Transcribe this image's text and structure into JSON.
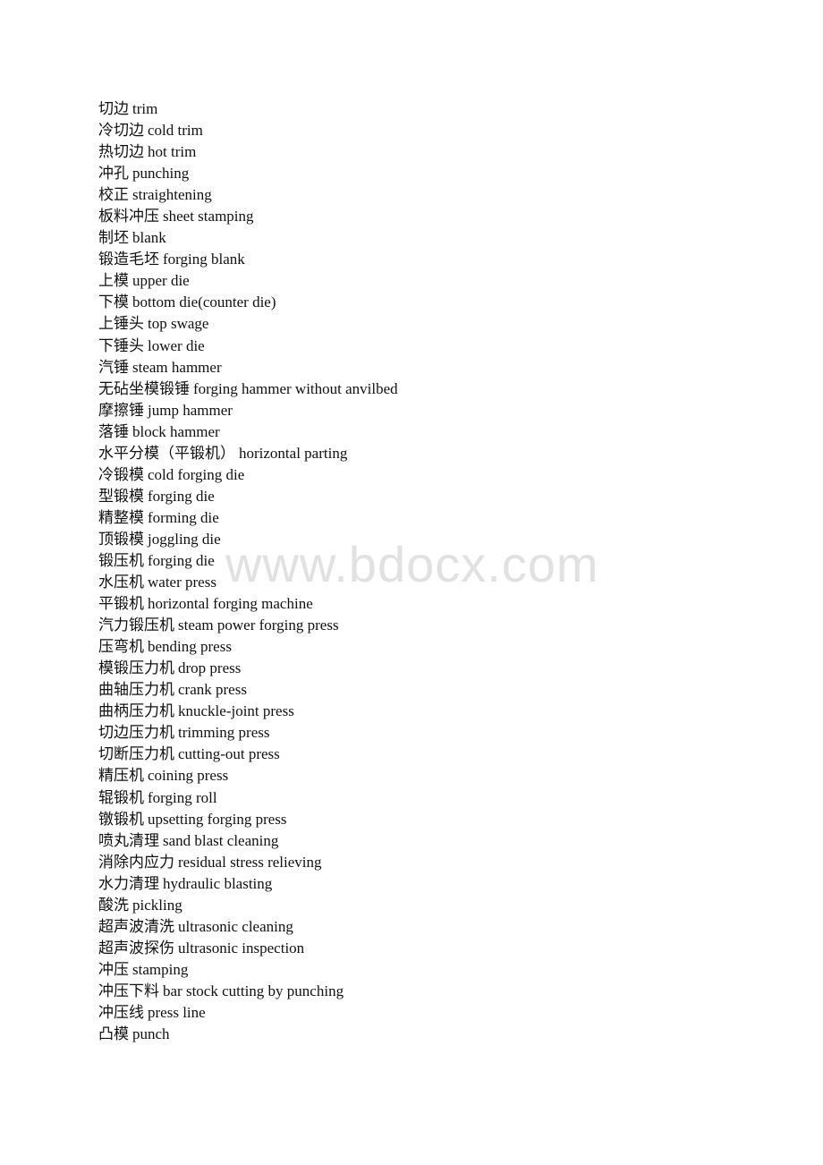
{
  "document": {
    "entries": [
      {
        "zh": "切边",
        "en": "trim"
      },
      {
        "zh": "冷切边",
        "en": "cold trim"
      },
      {
        "zh": "热切边",
        "en": "hot trim"
      },
      {
        "zh": "冲孔",
        "en": "punching"
      },
      {
        "zh": "校正",
        "en": "straightening"
      },
      {
        "zh": "板料冲压",
        "en": "sheet stamping"
      },
      {
        "zh": "制坯",
        "en": "blank"
      },
      {
        "zh": "锻造毛坯",
        "en": "forging blank"
      },
      {
        "zh": "上模",
        "en": "upper die"
      },
      {
        "zh": "下模",
        "en": "bottom die(counter die)"
      },
      {
        "zh": "上锤头",
        "en": "top swage"
      },
      {
        "zh": "下锤头",
        "en": "lower die"
      },
      {
        "zh": "汽锤",
        "en": "steam hammer"
      },
      {
        "zh": "无砧坐模锻锤",
        "en": "forging hammer without anvilbed"
      },
      {
        "zh": "摩擦锤",
        "en": "jump hammer"
      },
      {
        "zh": "落锤",
        "en": "block hammer"
      },
      {
        "zh": "水平分模（平锻机）",
        "en": "horizontal parting"
      },
      {
        "zh": "冷锻模",
        "en": "cold forging die"
      },
      {
        "zh": "型锻模",
        "en": "forging die"
      },
      {
        "zh": "精整模",
        "en": "forming die"
      },
      {
        "zh": "顶锻模",
        "en": "joggling die"
      },
      {
        "zh": "锻压机",
        "en": "forging die"
      },
      {
        "zh": "水压机",
        "en": "water press"
      },
      {
        "zh": "平锻机",
        "en": "horizontal forging machine"
      },
      {
        "zh": "汽力锻压机",
        "en": "steam power forging press"
      },
      {
        "zh": "压弯机",
        "en": "bending press"
      },
      {
        "zh": "模锻压力机",
        "en": "drop press"
      },
      {
        "zh": "曲轴压力机",
        "en": "crank press"
      },
      {
        "zh": "曲柄压力机",
        "en": "knuckle-joint press"
      },
      {
        "zh": "切边压力机",
        "en": "trimming press"
      },
      {
        "zh": "切断压力机",
        "en": "cutting-out press"
      },
      {
        "zh": "精压机",
        "en": "coining press"
      },
      {
        "zh": "辊锻机",
        "en": "forging roll"
      },
      {
        "zh": "镦锻机",
        "en": "upsetting forging press"
      },
      {
        "zh": "喷丸清理",
        "en": "sand blast cleaning"
      },
      {
        "zh": "消除内应力",
        "en": "residual stress relieving"
      },
      {
        "zh": "水力清理",
        "en": "hydraulic blasting"
      },
      {
        "zh": "酸洗",
        "en": "pickling"
      },
      {
        "zh": "超声波清洗",
        "en": "ultrasonic cleaning"
      },
      {
        "zh": "超声波探伤",
        "en": "ultrasonic inspection"
      },
      {
        "zh": "冲压",
        "en": "stamping"
      },
      {
        "zh": "冲压下料",
        "en": "bar stock cutting by punching"
      },
      {
        "zh": "冲压线",
        "en": "press line"
      },
      {
        "zh": "凸模",
        "en": "punch"
      }
    ]
  },
  "watermark": {
    "text": "www.bdocx.com"
  }
}
